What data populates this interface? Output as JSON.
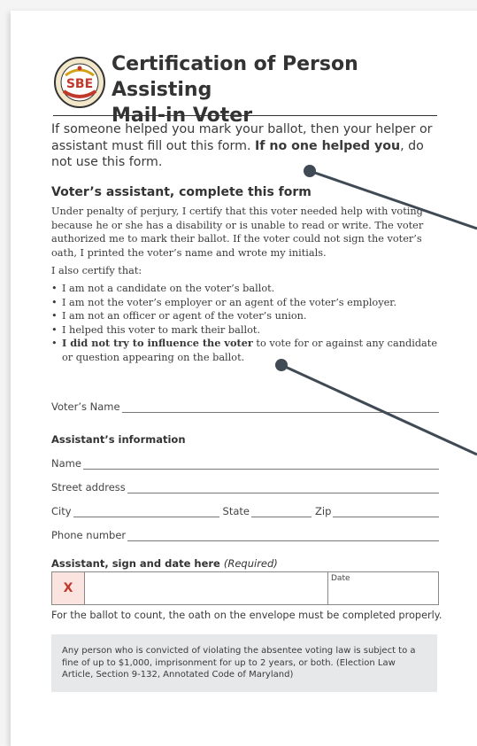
{
  "header": {
    "seal_text": "SBE",
    "title_line1": "Certification of Person Assisting",
    "title_line2": "Mail-in Voter"
  },
  "intro": {
    "part1": "If someone helped you mark your ballot, then your helper or assistant must fill out this form. ",
    "bold": "If no one helped you",
    "part2": ", do not use this form."
  },
  "assistant_section": {
    "heading": "Voter’s assistant, complete this form",
    "paragraph": "Under penalty of perjury, I certify that this voter needed help with voting because he or she has a disability or is unable to read or write. The voter authorized me to mark their ballot. If the voter could not sign the voter’s oath, I printed the voter’s name and wrote my initials.",
    "also": "I also certify that:",
    "bullets": [
      "I am not a candidate on the voter’s ballot.",
      "I am not the voter’s employer or an agent of the voter’s employer.",
      "I am not an officer or agent of the voter’s union.",
      "I helped this voter to mark their ballot."
    ],
    "last_bullet_bold": "I did not try to influence the voter",
    "last_bullet_rest": " to vote for or against any candidate or question appearing on the ballot."
  },
  "fields": {
    "voter_name": "Voter’s Name",
    "assistant_heading": "Assistant’s information",
    "name": "Name",
    "street": "Street address",
    "city": "City",
    "state": "State",
    "zip": "Zip",
    "phone": "Phone number"
  },
  "signature": {
    "heading": "Assistant, sign and date here",
    "required": "(Required)",
    "x_mark": "X",
    "date_label": "Date"
  },
  "footer": {
    "note": "For the ballot to count, the oath on the envelope must be completed properly.",
    "legal": "Any person who is convicted of violating the absentee voting law is subject to a fine of up to $1,000, imprisonment for up to 2 years, or both. (Election Law Article, Section 9-132, Annotated Code of Maryland)"
  },
  "colors": {
    "pointer": "#3f4a55",
    "sign_x": "#c0392b",
    "sign_bg": "#fbe4e0",
    "legal_bg": "#e7e8ea"
  }
}
